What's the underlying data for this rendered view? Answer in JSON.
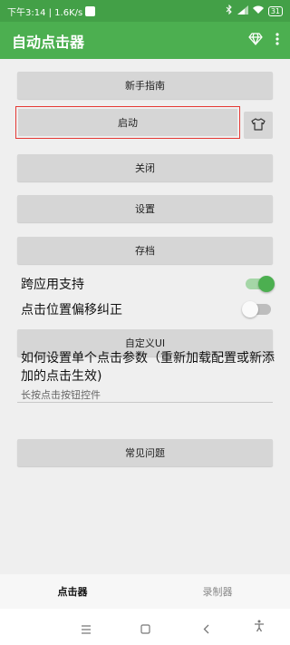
{
  "status_bar": {
    "time_speed": "下午3:14 | 1.6K/s",
    "battery": "31"
  },
  "app_bar": {
    "title": "自动点击器"
  },
  "buttons": {
    "guide": "新手指南",
    "start": "启动",
    "close": "关闭",
    "settings": "设置",
    "archive": "存档",
    "custom_ui": "自定义UI",
    "faq": "常见问题"
  },
  "toggles": {
    "cross_app": {
      "label": "跨应用支持",
      "on": true
    },
    "offset_fix": {
      "label": "点击位置偏移纠正",
      "on": false
    }
  },
  "help": {
    "title": "如何设置单个点击参数（重新加载配置或新添加的点击生效)",
    "subtitle": "长按点击按钮控件"
  },
  "bottom_nav": {
    "tab1": "点击器",
    "tab2": "录制器"
  },
  "colors": {
    "primary": "#4caf50",
    "status_bar": "#43a047",
    "button_bg": "#d6d6d6",
    "highlight_border": "#e53935"
  },
  "icons": [
    "diamond-icon",
    "more-vert-icon",
    "shirt-icon",
    "menu-icon",
    "home-icon",
    "back-icon",
    "accessibility-icon"
  ]
}
